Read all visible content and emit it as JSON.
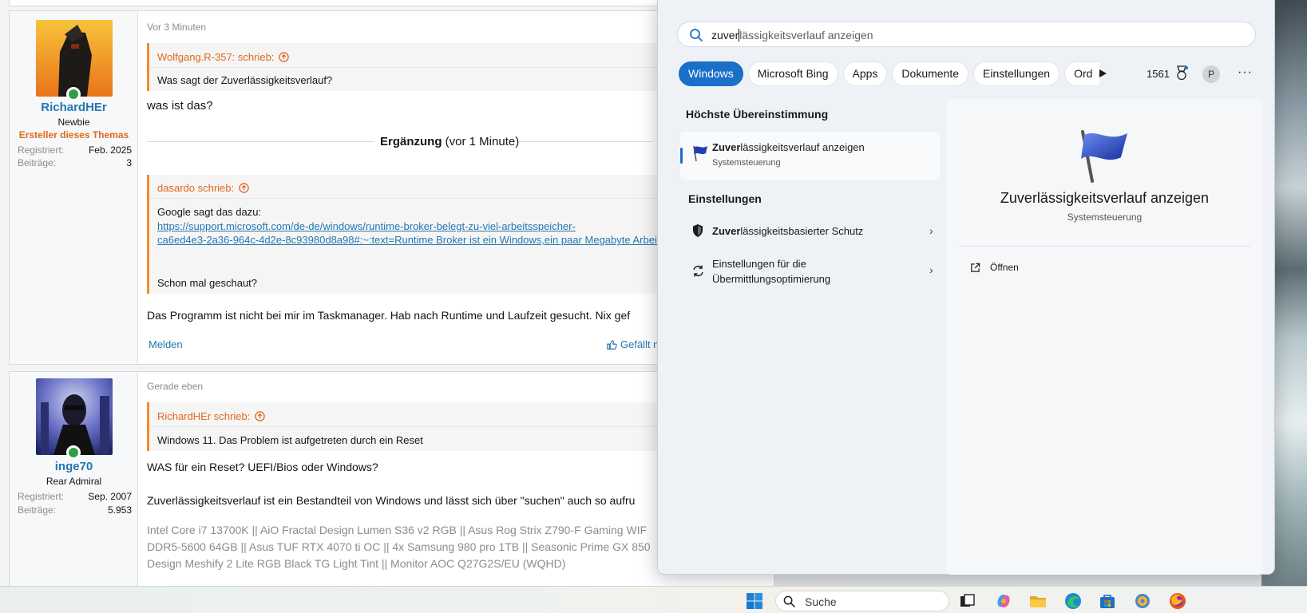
{
  "forum": {
    "post1": {
      "time": "Vor 3 Minuten",
      "user": {
        "name": "RichardHEr",
        "title": "Newbie",
        "starter": "Ersteller dieses Themas",
        "stats": [
          {
            "k": "Registriert:",
            "v": "Feb. 2025"
          },
          {
            "k": "Beiträge:",
            "v": "3"
          }
        ]
      },
      "quote1": {
        "author": "Wolfgang.R-357: schrieb:",
        "text": "Was sagt der Zuverlässigkeitsverlauf?"
      },
      "reply1": "was ist das?",
      "addition": {
        "label": "Ergänzung",
        "time": "(vor 1 Minute)"
      },
      "quote2": {
        "author": "dasardo schrieb:",
        "line1": "Google sagt das dazu:",
        "link1": "https://support.microsoft.com/de-de/windows/runtime-broker-belegt-zu-viel-arbeitsspeicher-",
        "link2": "ca6ed4e3-2a36-964c-4d2e-8c93980d8a98#:~:text=Runtime Broker ist ein Windows,ein paar Megabyte Arbeits",
        "line2": "Schon mal geschaut?"
      },
      "reply2": "Das Programm ist nicht bei mir im Taskmanager. Hab nach Runtime und Laufzeit gesucht. Nix gef",
      "report": "Melden",
      "like": "Gefällt mi"
    },
    "post2": {
      "time": "Gerade eben",
      "user": {
        "name": "inge70",
        "title": "Rear Admiral",
        "stats": [
          {
            "k": "Registriert:",
            "v": "Sep. 2007"
          },
          {
            "k": "Beiträge:",
            "v": "5.953"
          }
        ]
      },
      "quote": {
        "author": "RichardHEr schrieb:",
        "text": "Windows 11. Das Problem ist aufgetreten durch ein Reset"
      },
      "line1": "WAS für ein Reset? UEFI/Bios oder Windows?",
      "line2": "Zuverlässigkeitsverlauf ist ein Bestandteil von Windows und lässt sich über \"suchen\" auch so aufru",
      "signature": [
        "Intel Core i7 13700K || AiO Fractal Design Lumen S36 v2 RGB || Asus Rog Strix Z790-F Gaming WIF",
        "DDR5-5600 64GB || Asus TUF RTX 4070 ti OC || 4x Samsung 980 pro 1TB || Seasonic Prime GX 850",
        "Design Meshify 2 Lite RGB Black TG Light Tint || Monitor AOC Q27G2S/EU (WQHD)"
      ]
    }
  },
  "search": {
    "query_typed": "zuver",
    "query_rest": "lässigkeitsverlauf anzeigen",
    "chips": [
      "Windows",
      "Microsoft Bing",
      "Apps",
      "Dokumente",
      "Einstellungen",
      "Ord"
    ],
    "active_chip": "Windows",
    "points": "1561",
    "profile_initial": "P",
    "more": "···",
    "best_match_heading": "Höchste Übereinstimmung",
    "best_match": {
      "bold": "Zuver",
      "rest": "lässigkeitsverlauf anzeigen",
      "sub": "Systemsteuerung"
    },
    "settings_heading": "Einstellungen",
    "settings_items": [
      {
        "bold": "Zuver",
        "rest": "lässigkeitsbasierter Schutz",
        "icon": "shield-icon"
      },
      {
        "bold": "",
        "rest": "Einstellungen für die Übermittlungsoptimierung",
        "icon": "sync-icon"
      }
    ],
    "detail": {
      "title": "Zuverlässigkeitsverlauf anzeigen",
      "sub": "Systemsteuerung",
      "action": "Öffnen"
    }
  },
  "taskbar": {
    "search_label": "Suche",
    "colors": {
      "accent": "#1a6fc9",
      "forum_orange": "#e0691a",
      "forum_link": "#2577b1"
    }
  }
}
